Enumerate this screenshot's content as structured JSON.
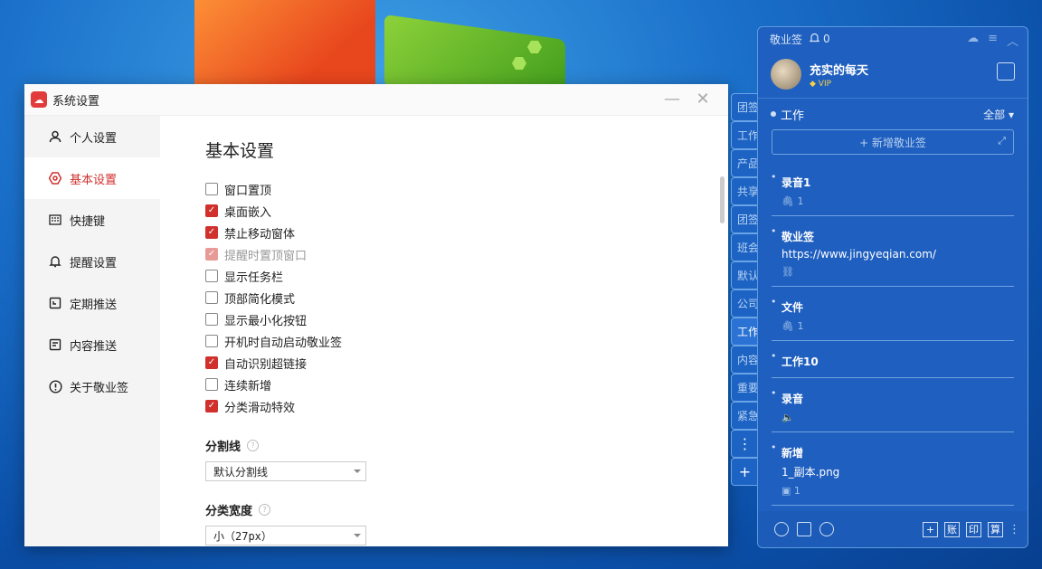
{
  "settings_window": {
    "title": "系统设置",
    "minimize": "—",
    "close": "✕"
  },
  "sidebar": {
    "items": [
      {
        "label": "个人设置",
        "icon": "user-icon"
      },
      {
        "label": "基本设置",
        "icon": "hexagon-settings-icon",
        "active": true
      },
      {
        "label": "快捷键",
        "icon": "keyboard-icon"
      },
      {
        "label": "提醒设置",
        "icon": "bell-icon"
      },
      {
        "label": "定期推送",
        "icon": "schedule-icon"
      },
      {
        "label": "内容推送",
        "icon": "document-icon"
      },
      {
        "label": "关于敬业签",
        "icon": "info-icon"
      }
    ]
  },
  "content": {
    "heading": "基本设置",
    "options": [
      {
        "label": "窗口置顶",
        "checked": false
      },
      {
        "label": "桌面嵌入",
        "checked": true
      },
      {
        "label": "禁止移动窗体",
        "checked": true
      },
      {
        "label": "提醒时置顶窗口",
        "checked": true,
        "disabled": true
      },
      {
        "label": "显示任务栏",
        "checked": false
      },
      {
        "label": "顶部简化模式",
        "checked": false
      },
      {
        "label": "显示最小化按钮",
        "checked": false
      },
      {
        "label": "开机时自动启动敬业签",
        "checked": false
      },
      {
        "label": "自动识别超链接",
        "checked": true
      },
      {
        "label": "连续新增",
        "checked": false
      },
      {
        "label": "分类滑动特效",
        "checked": true
      }
    ],
    "divider_label": "分割线",
    "divider_value": "默认分割线",
    "width_label": "分类宽度",
    "width_value": "小（27px）",
    "help": "?"
  },
  "side_tabs": [
    "团签",
    "工作",
    "产品",
    "共享",
    "团签",
    "班会",
    "默认",
    "公司",
    "工作",
    "内容",
    "重要",
    "紧急"
  ],
  "side_tabs_active_index": 8,
  "side_tab_more": "⋮",
  "side_tab_add": "+",
  "panel": {
    "app_name": "敬业签",
    "reminder_count": "0",
    "user_name": "充实的每天",
    "vip": "VIP",
    "category": "工作",
    "filter": "全部",
    "new_note": "+ 新增敬业签",
    "notes": [
      {
        "title": "录音1",
        "meta": "1",
        "meta_icon": "paperclip-icon"
      },
      {
        "title": "敬业签",
        "sub": "https://www.jingyeqian.com/",
        "meta": "",
        "meta_icon": "link-icon"
      },
      {
        "title": "文件",
        "meta": "1",
        "meta_icon": "paperclip-icon"
      },
      {
        "title": "工作10"
      },
      {
        "title": "录音",
        "meta": "",
        "meta_icon": "audio-icon"
      },
      {
        "title": "新增",
        "sub": "1_副本.png",
        "meta": "1",
        "meta_icon": "image-icon"
      }
    ],
    "bottom_buttons": [
      "+",
      "账",
      "印",
      "算"
    ]
  }
}
